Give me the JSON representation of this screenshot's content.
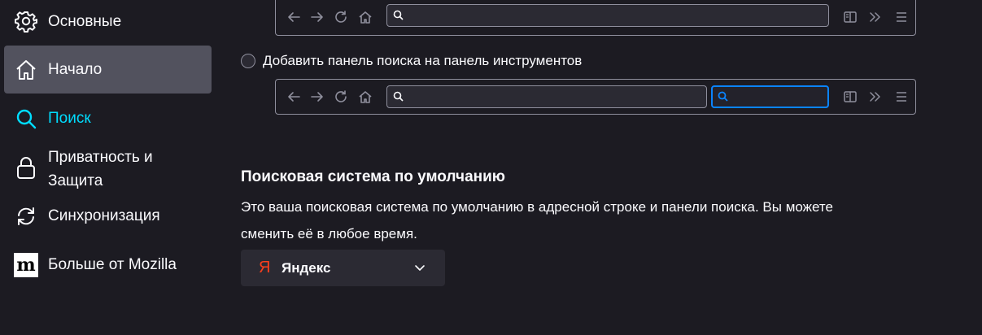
{
  "sidebar": {
    "items": [
      {
        "label": "Основные",
        "icon": "gear-icon",
        "state": "normal"
      },
      {
        "label": "Начало",
        "icon": "home-icon",
        "state": "active"
      },
      {
        "label": "Поиск",
        "icon": "search-icon",
        "state": "selected"
      },
      {
        "label": "Приватность и\nЗащита",
        "line1": "Приватность и",
        "line2": "Защита",
        "icon": "lock-icon",
        "state": "normal"
      },
      {
        "label": "Синхронизация",
        "icon": "sync-icon",
        "state": "normal"
      },
      {
        "label": "Больше от Mozilla",
        "icon": "mozilla-logo-icon",
        "state": "normal"
      }
    ]
  },
  "search_bar_option": {
    "label": "Добавить панель поиска на панель инструментов",
    "checked": false
  },
  "default_engine": {
    "title": "Поисковая система по умолчанию",
    "description_line1": "Это ваша поисковая система по умолчанию в адресной строке и панели поиска. Вы можете",
    "description_line2": "сменить её в любое время.",
    "selected": "Яндекс",
    "logo_glyph": "Я"
  },
  "colors": {
    "background": "#1c1b22",
    "accent": "#00ddff",
    "focus": "#0a84ff",
    "active_item": "#52525e",
    "yandex": "#fc3f1d"
  }
}
